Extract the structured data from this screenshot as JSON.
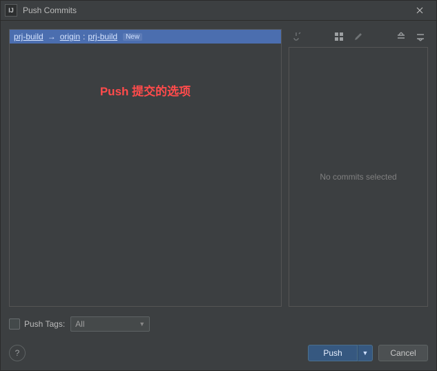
{
  "window": {
    "title": "Push Commits",
    "app_icon_text": "IJ"
  },
  "branch": {
    "local": "prj-build",
    "remote": "origin",
    "remote_branch": "prj-build",
    "new_tag": "New",
    "arrow": "→",
    "colon": ":"
  },
  "annotation": "Push 提交的选项",
  "preview": {
    "empty_text": "No commits selected"
  },
  "toolbar": {
    "cherry_pick": "cherry-pick",
    "group": "group-by",
    "edit": "edit",
    "expand": "expand-all",
    "collapse": "collapse-all"
  },
  "push_tags": {
    "label": "Push Tags:",
    "selected": "All"
  },
  "footer": {
    "help": "?",
    "push": "Push",
    "cancel": "Cancel"
  }
}
